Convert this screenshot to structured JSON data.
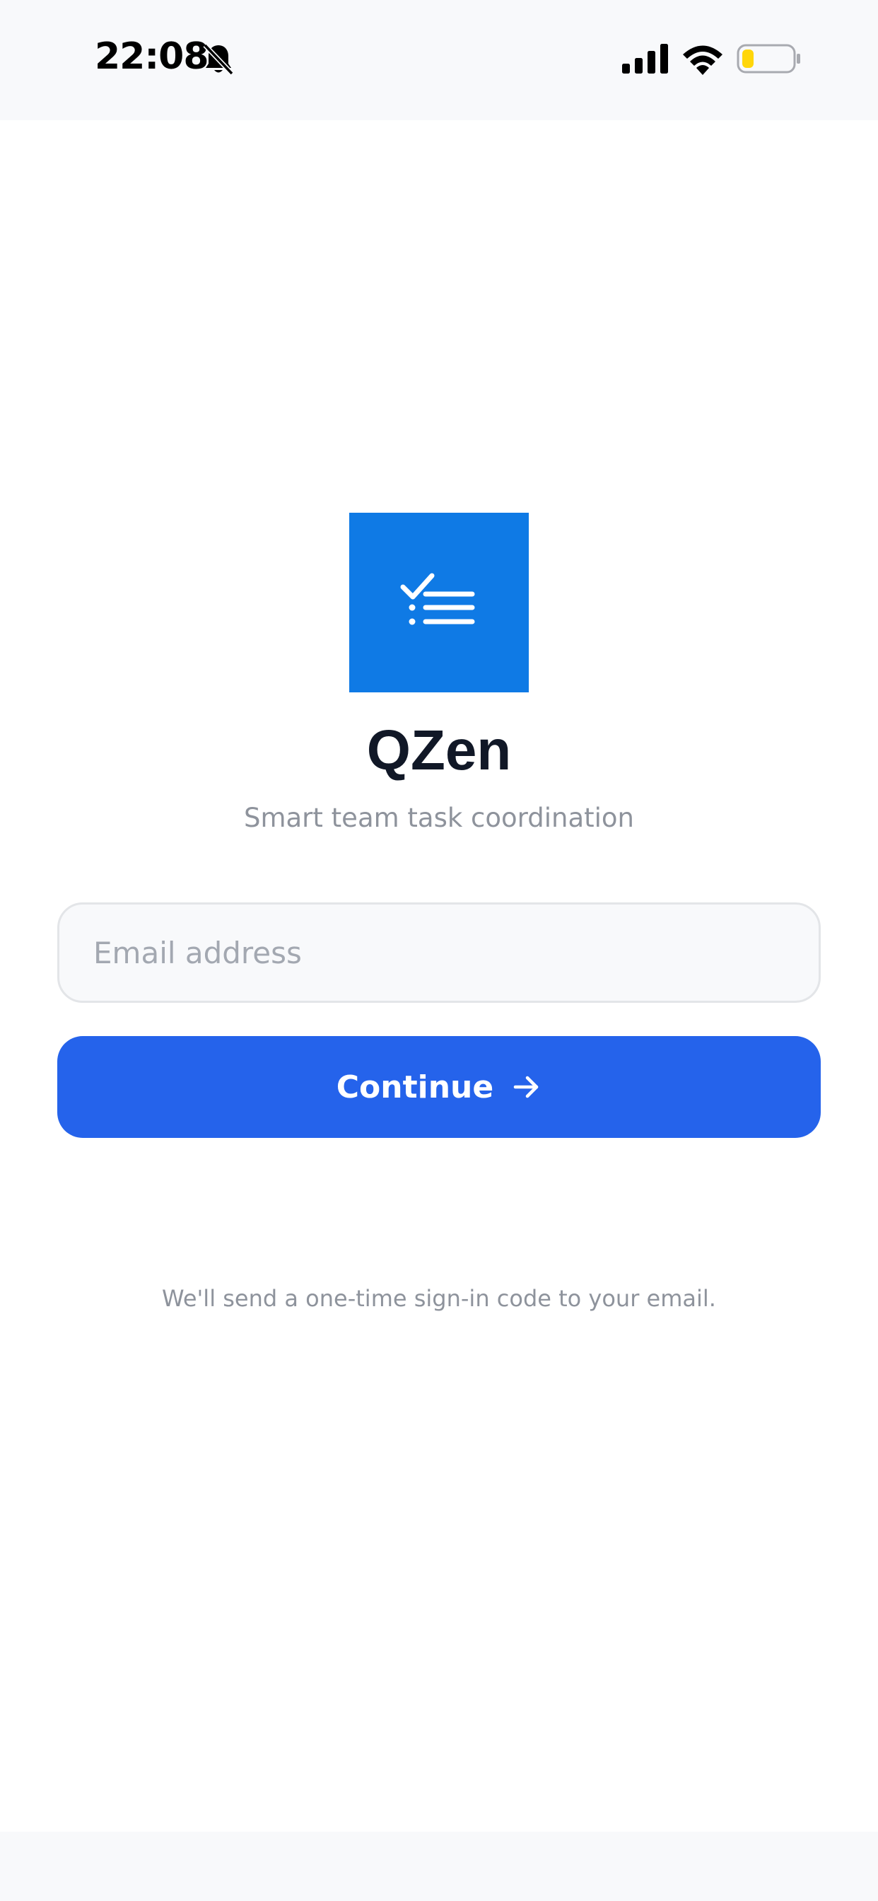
{
  "status_bar": {
    "time": "22:08",
    "icons": [
      "bell-slash-icon",
      "cellular-signal-icon",
      "wifi-icon",
      "battery-icon"
    ],
    "battery_level": 0.2,
    "battery_color": "#ffd60a"
  },
  "app": {
    "logo_icon": "checklist-icon",
    "logo_color": "#0f7ae5",
    "name": "QZen",
    "tagline": "Smart team task coordination"
  },
  "form": {
    "email_placeholder": "Email address",
    "email_value": "",
    "continue_label": "Continue",
    "continue_icon": "arrow-right-icon",
    "accent_color": "#2563eb",
    "helper_text": "We'll send a one-time sign-in code to your email."
  }
}
